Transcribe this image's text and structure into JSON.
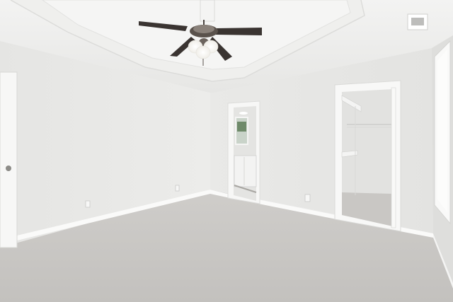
{
  "scene": {
    "description_tags": [
      "empty-bedroom",
      "tray-ceiling",
      "ceiling-fan",
      "carpet",
      "walk-in-closet",
      "bathroom-doorway",
      "window"
    ]
  }
}
